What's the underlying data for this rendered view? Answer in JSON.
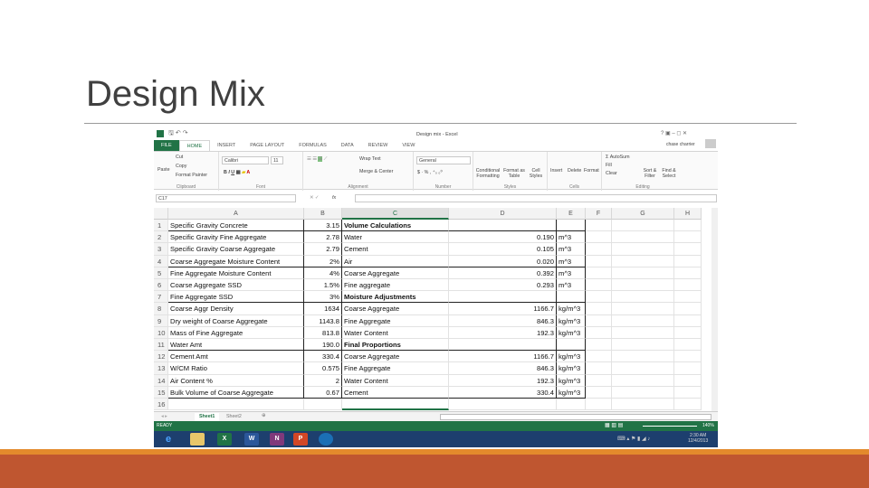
{
  "slide": {
    "title": "Design Mix",
    "colors": {
      "accent_line": "#e38a2c",
      "footer": "#bf5630"
    }
  },
  "excel": {
    "window_title": "Design mix - Excel",
    "user": "chase charrier",
    "tabs": [
      "FILE",
      "HOME",
      "INSERT",
      "PAGE LAYOUT",
      "FORMULAS",
      "DATA",
      "REVIEW",
      "VIEW"
    ],
    "ribbon": {
      "clipboard": {
        "paste": "Paste",
        "cut": "Cut",
        "copy": "Copy",
        "format_painter": "Format Painter",
        "label": "Clipboard"
      },
      "font": {
        "name": "Calibri",
        "size": "11",
        "label": "Font"
      },
      "alignment": {
        "wrap": "Wrap Text",
        "merge": "Merge & Center",
        "label": "Alignment"
      },
      "number": {
        "format": "General",
        "label": "Number"
      },
      "styles": {
        "conditional": "Conditional Formatting",
        "format_table": "Format as Table",
        "cell_styles": "Cell Styles",
        "label": "Styles"
      },
      "cells": {
        "insert": "Insert",
        "delete": "Delete",
        "format": "Format",
        "label": "Cells"
      },
      "editing": {
        "autosum": "AutoSum",
        "fill": "Fill",
        "clear": "Clear",
        "sort": "Sort & Filter",
        "find": "Find & Select",
        "label": "Editing"
      }
    },
    "name_box": "C17",
    "fx": "fx",
    "columns": [
      "A",
      "B",
      "C",
      "D",
      "E",
      "F",
      "G",
      "H"
    ],
    "selected_column": "C",
    "rows": [
      [
        "1",
        "Specific Gravity Concrete",
        "3.15",
        "Volume Calculations",
        "",
        ""
      ],
      [
        "2",
        "Specific Gravity Fine Aggregate",
        "2.78",
        "Water",
        "0.190",
        "m^3"
      ],
      [
        "3",
        "Specific Gravity Coarse Aggregate",
        "2.79",
        "Cement",
        "0.105",
        "m^3"
      ],
      [
        "4",
        "Coarse Aggregate Moisture Content",
        "2%",
        "Air",
        "0.020",
        "m^3"
      ],
      [
        "5",
        "Fine Aggregate Moisture Content",
        "4%",
        "Coarse Aggregate",
        "0.392",
        "m^3"
      ],
      [
        "6",
        "Coarse Aggregate SSD",
        "1.5%",
        "Fine aggregate",
        "0.293",
        "m^3"
      ],
      [
        "7",
        "Fine Aggregate SSD",
        "3%",
        "Moisture Adjustments",
        "",
        ""
      ],
      [
        "8",
        "Coarse Aggr Density",
        "1634",
        "Coarse Aggregate",
        "1166.7",
        "kg/m^3"
      ],
      [
        "9",
        "Dry weight of Coarse Aggregate",
        "1143.8",
        "Fine Aggregate",
        "846.3",
        "kg/m^3"
      ],
      [
        "10",
        "Mass of Fine Aggregate",
        "813.8",
        "Water Content",
        "192.3",
        "kg/m^3"
      ],
      [
        "11",
        "Water Amt",
        "190.0",
        "Final Proportions",
        "",
        ""
      ],
      [
        "12",
        "Cement Amt",
        "330.4",
        "Coarse Aggregate",
        "1166.7",
        "kg/m^3"
      ],
      [
        "13",
        "W/CM Ratio",
        "0.575",
        "Fine Aggregate",
        "846.3",
        "kg/m^3"
      ],
      [
        "14",
        "Air Content %",
        "2",
        "Water Content",
        "192.3",
        "kg/m^3"
      ],
      [
        "15",
        "Bulk Volume of Coarse Aggregate",
        "0.67",
        "Cement",
        "330.4",
        "kg/m^3"
      ],
      [
        "16",
        "",
        "",
        "",
        "",
        ""
      ]
    ],
    "bold_rows": [
      1,
      7,
      11
    ],
    "sheets": [
      "Sheet1",
      "Sheet2"
    ],
    "status": "READY",
    "zoom": "140%",
    "taskbar": {
      "time": "2:30 AM",
      "date": "12/4/2013"
    }
  }
}
